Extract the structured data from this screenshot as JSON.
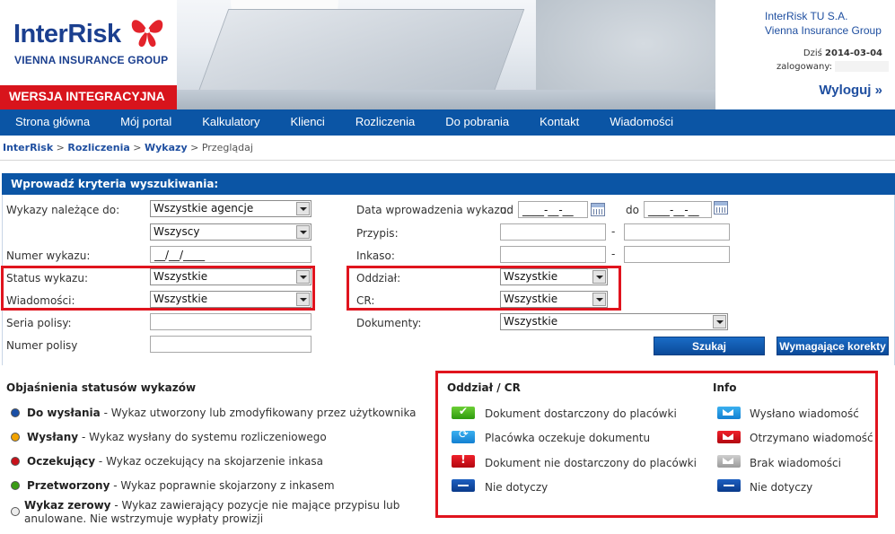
{
  "header": {
    "logo_text": "InterRisk",
    "logo_sub": "VIENNA INSURANCE GROUP",
    "version_label": "WERSJA INTEGRACYJNA",
    "company_line1": "InterRisk TU S.A.",
    "company_line2": "Vienna Insurance Group",
    "today_label": "Dziś",
    "today_date": "2014-03-04",
    "logged_label": "zalogowany:",
    "logout_label": "Wyloguj",
    "logout_icon": "»"
  },
  "nav": {
    "items": [
      "Strona główna",
      "Mój portal",
      "Kalkulatory",
      "Klienci",
      "Rozliczenia",
      "Do pobrania",
      "Kontakt",
      "Wiadomości"
    ]
  },
  "breadcrumb": {
    "items": [
      "InterRisk",
      "Rozliczenia",
      "Wykazy"
    ],
    "current": "Przeglądaj",
    "separator": ">"
  },
  "search": {
    "title": "Wprowadź kryteria wyszukiwania:",
    "wykazy_label": "Wykazy należące do:",
    "wykazy_value1": "Wszystkie agencje",
    "wykazy_value2": "Wszyscy",
    "numer_label": "Numer wykazu:",
    "numer_value": "__/__/____",
    "status_label": "Status wykazu:",
    "status_value": "Wszystkie",
    "wiadomosci_label": "Wiadomości:",
    "wiadomosci_value": "Wszystkie",
    "seria_label": "Seria polisy:",
    "numer_polisy_label": "Numer polisy",
    "data_label": "Data wprowadzenia wykazu:",
    "od_label": "od",
    "do_label": "do",
    "date_placeholder": "____-__-__",
    "przypis_label": "Przypis:",
    "inkaso_label": "Inkaso:",
    "range_dash": "-",
    "oddzial_label": "Oddział:",
    "oddzial_value": "Wszystkie",
    "cr_label": "CR:",
    "cr_value": "Wszystkie",
    "dokumenty_label": "Dokumenty:",
    "dokumenty_value": "Wszystkie",
    "search_button": "Szukaj",
    "corrections_button": "Wymagające korekty"
  },
  "status_legend": {
    "title": "Objaśnienia statusów wykazów",
    "items": [
      {
        "name": "Do wysłania",
        "desc": " - Wykaz utworzony lub zmodyfikowany przez użytkownika",
        "color": "#1a4fa6"
      },
      {
        "name": "Wysłany",
        "desc": " - Wykaz wysłany do systemu rozliczeniowego",
        "color": "#f2a300"
      },
      {
        "name": "Oczekujący",
        "desc": " - Wykaz oczekujący na skojarzenie inkasa",
        "color": "#c8111a"
      },
      {
        "name": "Przetworzony",
        "desc": " - Wykaz poprawnie skojarzony z inkasem",
        "color": "#3a9b15"
      },
      {
        "name": "Wykaz zerowy",
        "desc": " - Wykaz zawierający pozycje nie mające przypisu lub anulowane. Nie wstrzymuje wypłaty prowizji",
        "color": "#ededed"
      }
    ]
  },
  "oddzial_legend": {
    "title": "Oddział / CR",
    "items": [
      {
        "label": "Dokument dostarczony do placówki",
        "icon": "check-green-icon"
      },
      {
        "label": "Placówka oczekuje dokumentu",
        "icon": "sync-blue-icon"
      },
      {
        "label": "Dokument nie dostarczony do placówki",
        "icon": "exclamation-red-icon"
      },
      {
        "label": "Nie dotyczy",
        "icon": "minus-navy-icon"
      }
    ]
  },
  "info_legend": {
    "title": "Info",
    "items": [
      {
        "label": "Wysłano wiadomość",
        "icon": "envelope-blue-icon"
      },
      {
        "label": "Otrzymano wiadomość",
        "icon": "envelope-red-icon"
      },
      {
        "label": "Brak wiadomości",
        "icon": "envelope-grey-icon"
      },
      {
        "label": "Nie dotyczy",
        "icon": "minus-navy-icon"
      }
    ]
  },
  "colors": {
    "brand_blue": "#0b55a5",
    "brand_red": "#d8141c",
    "highlight_red": "#e0141e"
  }
}
